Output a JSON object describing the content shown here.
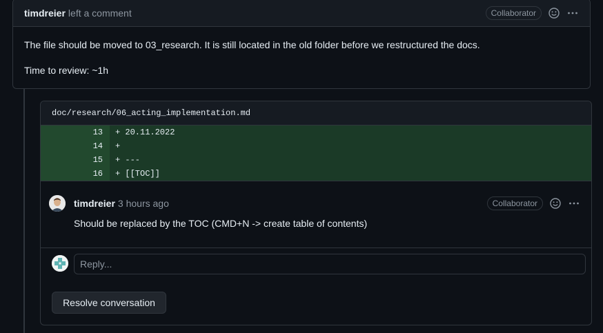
{
  "top_comment": {
    "author": "timdreier",
    "action": "left a comment",
    "badge": "Collaborator",
    "body": [
      "The file should be moved to 03_research. It is still located in the old folder before we restructured the docs.",
      "Time to review: ~1h"
    ]
  },
  "thread": {
    "file_path": "doc/research/06_acting_implementation.md",
    "diff_lines": [
      {
        "num": "13",
        "code": "+ 20.11.2022"
      },
      {
        "num": "14",
        "code": "+"
      },
      {
        "num": "15",
        "code": "+ ---"
      },
      {
        "num": "16",
        "code": "+ [[TOC]]"
      }
    ],
    "comment": {
      "author": "timdreier",
      "time": "3 hours ago",
      "badge": "Collaborator",
      "body": "Should be replaced by the TOC (CMD+N -> create table of contents)"
    },
    "reply_placeholder": "Reply...",
    "resolve_label": "Resolve conversation"
  }
}
